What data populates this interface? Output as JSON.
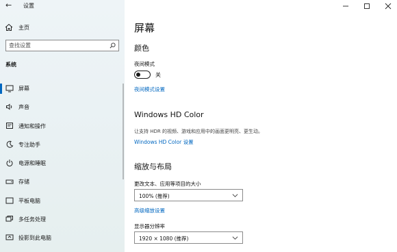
{
  "window": {
    "title": "设置"
  },
  "sidebar": {
    "home_label": "主页",
    "search_placeholder": "查找设置",
    "section": "系统",
    "items": [
      {
        "label": "屏幕",
        "icon": "monitor-icon",
        "selected": true
      },
      {
        "label": "声音",
        "icon": "speaker-icon"
      },
      {
        "label": "通知和操作",
        "icon": "notification-icon"
      },
      {
        "label": "专注助手",
        "icon": "moon-icon"
      },
      {
        "label": "电源和睡眠",
        "icon": "power-icon"
      },
      {
        "label": "存储",
        "icon": "storage-icon"
      },
      {
        "label": "平板电脑",
        "icon": "tablet-icon"
      },
      {
        "label": "多任务处理",
        "icon": "multitask-icon"
      },
      {
        "label": "投影到此电脑",
        "icon": "project-icon"
      }
    ]
  },
  "main": {
    "page_title": "屏幕",
    "color": {
      "heading": "颜色",
      "night_mode_label": "夜间模式",
      "night_mode_state": "关",
      "night_mode_settings_link": "夜间模式设置"
    },
    "hdr": {
      "heading": "Windows HD Color",
      "description": "让支持 HDR 的视频、游戏和应用中的画面更明亮、更生动。",
      "settings_link": "Windows HD Color 设置"
    },
    "scale": {
      "heading": "缩放与布局",
      "text_size_label": "更改文本、应用等项目的大小",
      "text_size_value": "100% (推荐)",
      "advanced_link": "高级缩放设置",
      "resolution_label": "显示器分辨率",
      "resolution_value": "1920 × 1080 (推荐)"
    }
  },
  "colors": {
    "accent": "#0067c0",
    "sidebar_bg": "#eaf2f4"
  }
}
